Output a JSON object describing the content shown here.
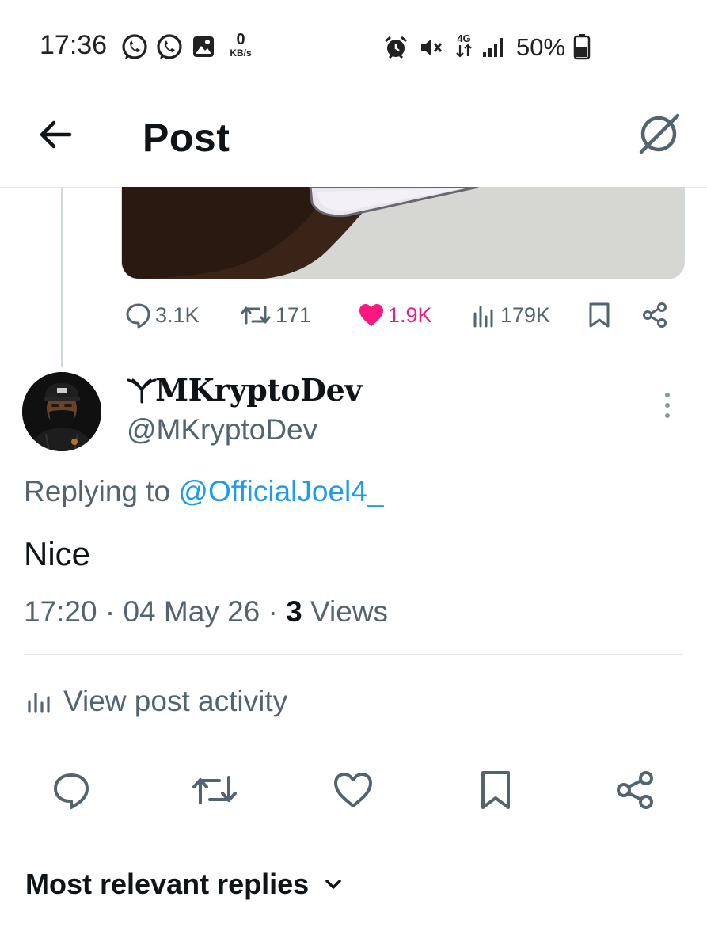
{
  "status_bar": {
    "time": "17:36",
    "net_speed_value": "0",
    "net_speed_unit": "KB/s",
    "network_type": "4G",
    "battery": "50%",
    "icons": [
      "whatsapp-icon",
      "whatsapp-icon",
      "gallery-icon",
      "alarm-icon",
      "mute-icon",
      "network-4g-icon",
      "signal-icon",
      "battery-icon"
    ]
  },
  "header": {
    "title": "Post",
    "back_icon": "arrow-left-icon",
    "grok_icon": "grok-icon"
  },
  "parent_post": {
    "actions": {
      "replies": "3.1K",
      "reposts": "171",
      "likes": "1.9K",
      "views": "179K"
    },
    "liked": true,
    "like_color": "#f91880"
  },
  "reply": {
    "display_name": "MKryptoDev",
    "handle": "@MKryptoDev",
    "replying_prefix": "Replying to ",
    "replying_to": "@OfficialJoel4_",
    "text": "Nice",
    "time": "17:20",
    "date": "04 May 26",
    "separator": " · ",
    "views_count": "3",
    "views_label": "Views",
    "view_activity": "View post activity"
  },
  "replies_filter": {
    "label": "Most relevant replies"
  },
  "colors": {
    "accent": "#1d9bf0",
    "secondary_text": "#536471",
    "like": "#f91880",
    "border": "#e6e9ec"
  }
}
